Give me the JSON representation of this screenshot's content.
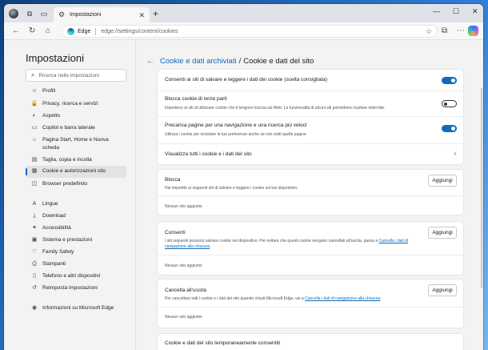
{
  "browser": {
    "tab_title": "Impostazioni",
    "tab_close": "✕",
    "new_tab": "+",
    "window_controls": [
      "—",
      "☐",
      "✕"
    ],
    "brand": "Edge",
    "url": "edge://settings/content/cookies"
  },
  "sidebar": {
    "title": "Impostazioni",
    "search_placeholder": "Ricerca nelle impostazioni",
    "items": [
      {
        "label": "Profili",
        "icon": "profile-icon",
        "glyph": "☺"
      },
      {
        "label": "Privacy, ricerca e servizi",
        "icon": "lock-icon",
        "glyph": "🔒"
      },
      {
        "label": "Aspetto",
        "icon": "palette-icon",
        "glyph": "◐"
      },
      {
        "label": "Copilot e barra laterale",
        "icon": "sidebar-icon",
        "glyph": "▭"
      },
      {
        "label": "Pagina Start, Home e Nuova scheda",
        "icon": "home-icon",
        "glyph": "⌂"
      },
      {
        "label": "Taglia, copia e incolla",
        "icon": "clipboard-icon",
        "glyph": "▤"
      },
      {
        "label": "Cookie e autorizzazioni sito",
        "icon": "cookie-icon",
        "glyph": "▦"
      },
      {
        "label": "Browser predefinito",
        "icon": "browser-icon",
        "glyph": "◫"
      },
      {
        "label": "Lingue",
        "icon": "language-icon",
        "glyph": "A"
      },
      {
        "label": "Download",
        "icon": "download-icon",
        "glyph": "⤓"
      },
      {
        "label": "Accessibilità",
        "icon": "accessibility-icon",
        "glyph": "✦"
      },
      {
        "label": "Sistema e prestazioni",
        "icon": "system-icon",
        "glyph": "▣"
      },
      {
        "label": "Family Safety",
        "icon": "family-icon",
        "glyph": "♡"
      },
      {
        "label": "Stampanti",
        "icon": "printer-icon",
        "glyph": "⎙"
      },
      {
        "label": "Telefono e altri dispositivi",
        "icon": "phone-icon",
        "glyph": "▯"
      },
      {
        "label": "Reimposta impostazioni",
        "icon": "reset-icon",
        "glyph": "↺"
      },
      {
        "label": "Informazioni su Microsoft Edge",
        "icon": "edge-icon",
        "glyph": "◉"
      }
    ]
  },
  "main": {
    "breadcrumb_link": "Cookie e dati archiviati",
    "breadcrumb_sep": "/",
    "breadcrumb_current": "Cookie e dati del sito",
    "settings": [
      {
        "title": "Consenti ai siti di salvare e leggere i dati dei cookie (scelta consigliata)",
        "desc": "",
        "enabled": true
      },
      {
        "title": "Blocca cookie di terze parti",
        "desc": "Impedisce ai siti di utilizzare cookie che ti tengono traccia sul Web. Le funzionalità di alcuni siti potrebbero risultare interrotte.",
        "enabled": false
      },
      {
        "title": "Precarica pagine per una navigazione e una ricerca più veloci",
        "desc": "Utilizza i cookie per ricordare le tue preferenze anche se non visiti quelle pagine",
        "enabled": true
      },
      {
        "title": "Visualizza tutti i cookie e i dati del sito",
        "desc": ""
      }
    ],
    "add_label": "Aggiungi",
    "empty_label": "Nessun sito aggiunto",
    "block": {
      "title": "Blocca",
      "desc": "Hai impedito ai seguenti siti di salvare e leggere i cookie sul tuo dispositivo."
    },
    "allow": {
      "title": "Consenti",
      "desc": "I siti seguenti possono salvare cookie nel dispositivo. Per evitare che questi cookie vengano cancellati all'uscita, passa a ",
      "link": "Cancella i dati di navigazione alla chiusura",
      "desc_end": "."
    },
    "clear": {
      "title": "Cancella all'uscita",
      "desc": "Per cancellare tutti i cookie e i dati del sito quando chiudi Microsoft Edge, vai a ",
      "link": "Cancella i dati di navigazione alla chiusura",
      "desc_end": "."
    },
    "temp": {
      "title": "Cookie e dati del sito temporaneamente consentiti"
    }
  }
}
